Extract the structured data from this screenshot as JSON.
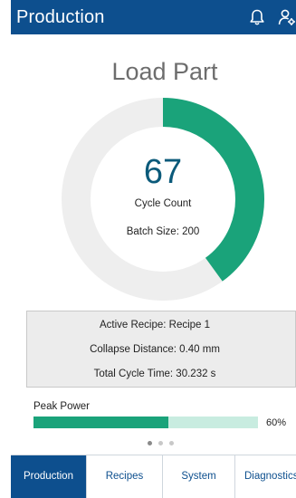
{
  "header": {
    "title": "Production",
    "icons": [
      "bell-icon",
      "user-settings-icon"
    ]
  },
  "main": {
    "title": "Load Part",
    "cycle_count": {
      "value": "67",
      "label": "Cycle Count",
      "progress_fraction": 0.4
    },
    "batch_size_text": "Batch Size: 200"
  },
  "info": {
    "active_recipe": "Active Recipe: Recipe 1",
    "collapse_distance": "Collapse Distance: 0.40 mm",
    "total_cycle_time": "Total Cycle Time: 30.232 s"
  },
  "peak_power": {
    "label": "Peak Power",
    "percent_text": "60%",
    "fraction": 0.6
  },
  "pager": {
    "count": 3,
    "active": 0
  },
  "nav": {
    "tabs": [
      {
        "label": "Production",
        "active": true
      },
      {
        "label": "Recipes",
        "active": false
      },
      {
        "label": "System",
        "active": false
      },
      {
        "label": "Diagnostics",
        "active": false
      }
    ]
  },
  "colors": {
    "primary": "#0d4f8e",
    "accent": "#1aa37a",
    "track": "#eeeeee",
    "bar_track": "#c8ece0",
    "value_text": "#0b5a7a"
  }
}
